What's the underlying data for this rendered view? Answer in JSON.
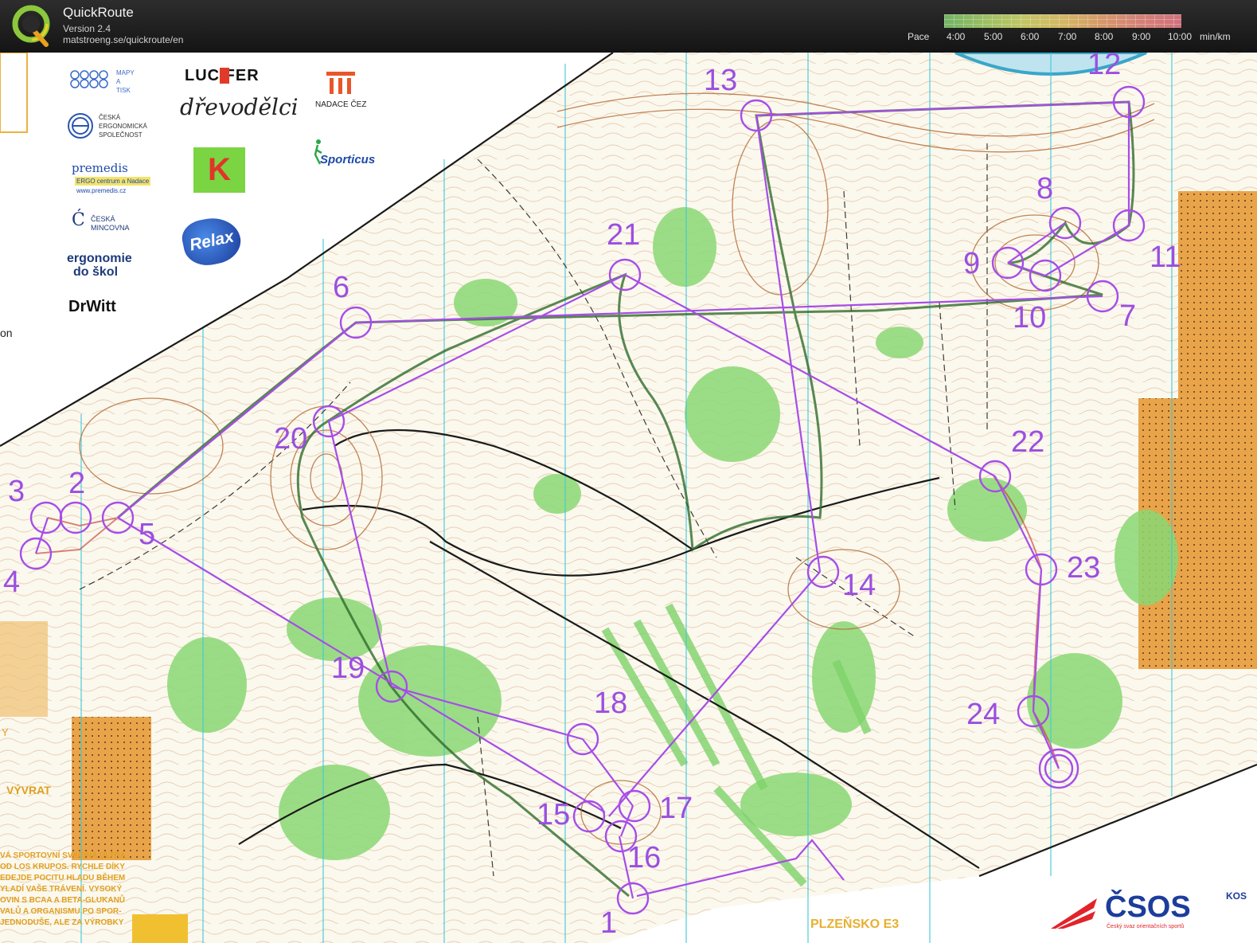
{
  "header": {
    "app_title": "QuickRoute",
    "version": "Version 2.4",
    "url": "matstroeng.se/quickroute/en",
    "logo_letter": "Q"
  },
  "pace_legend": {
    "label": "Pace",
    "ticks": [
      "4:00",
      "5:00",
      "6:00",
      "7:00",
      "8:00",
      "9:00",
      "10:00"
    ],
    "unit": "min/km"
  },
  "sponsors": {
    "mapy_a_tisk": [
      "MAPY",
      "A",
      "TISK"
    ],
    "lucifer": "LUC  FER",
    "nadace_cez": "NADACE ČEZ",
    "ergonomicka": [
      "ČESKÁ",
      "ERGONOMICKÁ",
      "SPOLEČNOST"
    ],
    "drevodilci": "dřevodělci",
    "premedis": [
      "premedis",
      "ERGO centrum a Nadace",
      "www.premedis.cz"
    ],
    "kofola": "K",
    "sporticus": "Sporticus",
    "mincovna": [
      "ČESKÁ",
      "MINCOVNA"
    ],
    "relax": "Relax",
    "ergonomie": [
      "ergonomie",
      "do škol"
    ],
    "drwitt": "DrWitt"
  },
  "controls": [
    {
      "number": "1"
    },
    {
      "number": "2"
    },
    {
      "number": "3"
    },
    {
      "number": "4"
    },
    {
      "number": "5"
    },
    {
      "number": "6"
    },
    {
      "number": "7"
    },
    {
      "number": "8"
    },
    {
      "number": "9"
    },
    {
      "number": "10"
    },
    {
      "number": "11"
    },
    {
      "number": "12"
    },
    {
      "number": "13"
    },
    {
      "number": "14"
    },
    {
      "number": "15"
    },
    {
      "number": "16"
    },
    {
      "number": "17"
    },
    {
      "number": "18"
    },
    {
      "number": "19"
    },
    {
      "number": "20"
    },
    {
      "number": "21"
    },
    {
      "number": "22"
    },
    {
      "number": "23"
    },
    {
      "number": "24"
    }
  ],
  "map_text": {
    "vyvrat": "VÝVRAT",
    "plzensko": "PLZEŇSKO E3",
    "left_letters": [
      "on",
      "Y"
    ],
    "ad_lines": [
      "VÁ SPORTOVNÍ SVAČINA ULTRA",
      "OD LOS KRUPOS. RYCHLE DÍKY",
      "EDEJDE POCITU HLADU BĚHEM",
      "YLADÍ VAŠE TRÁVENÍ. VYSOKÝ",
      "OVIN S BCAA A BETA-GLUKANŮ",
      "VALŮ A ORGANISMU PO SPOR-",
      "JEDNODUŠE, ALE ZA VÝROBKY"
    ],
    "csos": "ČSOS",
    "csos_sub": "Český svaz orientačních sportů",
    "kos": "KOS"
  },
  "colors": {
    "course_purple": "#a64de8",
    "contour_brown": "#b5703a",
    "vegetation_green": "#7fd36a",
    "open_land_yellow": "#f2c97a",
    "magnetic_north_cyan": "#3cc8d8",
    "water_blue": "#3aa6c8"
  }
}
